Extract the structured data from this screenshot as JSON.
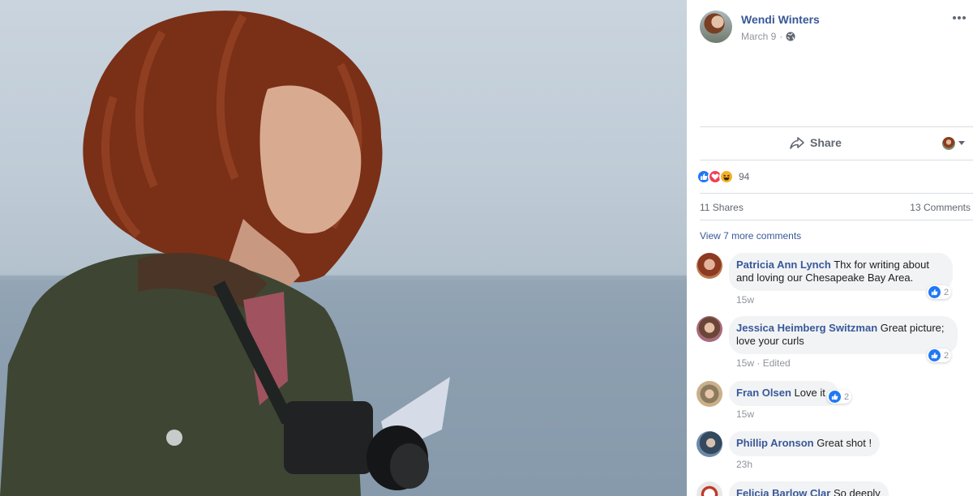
{
  "post": {
    "author": "Wendi Winters",
    "date": "March 9",
    "separator": "·",
    "privacy_icon": "globe-icon",
    "menu_icon": "more-options-icon"
  },
  "actions": {
    "share_label": "Share",
    "share_icon": "share-arrow-icon"
  },
  "reactions": {
    "types": [
      "like",
      "love",
      "haha"
    ],
    "count": "94"
  },
  "stats": {
    "shares": "11 Shares",
    "comments": "13 Comments"
  },
  "view_more": "View 7 more comments",
  "comments": [
    {
      "name": "Patricia Ann Lynch",
      "text": "Thx for writing about and loving our Chesapeake Bay Area.",
      "time": "15w",
      "edited": "",
      "likes": "2"
    },
    {
      "name": "Jessica Heimberg Switzman",
      "text": "Great picture; love your curls",
      "time": "15w",
      "edited": "Edited",
      "likes": "2"
    },
    {
      "name": "Fran Olsen",
      "text": "Love it",
      "time": "15w",
      "edited": "",
      "likes": "2"
    },
    {
      "name": "Phillip Aronson",
      "text": "Great shot !",
      "time": "23h",
      "edited": "",
      "likes": ""
    },
    {
      "name": "Felicia Barlow Clar",
      "text": "So deeply",
      "time": "",
      "edited": "",
      "likes": ""
    }
  ],
  "colors": {
    "link": "#385898",
    "muted": "#90949c",
    "bubble": "#f2f3f5",
    "like_blue": "#2078f4",
    "love_red": "#f33e58",
    "haha_yellow": "#f7b125"
  }
}
